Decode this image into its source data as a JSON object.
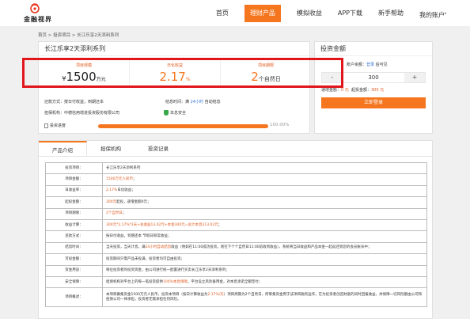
{
  "brand": {
    "logo_text": "金融视界",
    "accent": "#f5761e",
    "alert_box_color": "#e0161b"
  },
  "nav": [
    {
      "label": "首页",
      "active": false
    },
    {
      "label": "理财产品",
      "active": true
    },
    {
      "label": "模拟收益",
      "active": false
    },
    {
      "label": "APP下载",
      "active": false
    },
    {
      "label": "新手帮助",
      "active": false
    },
    {
      "label": "我的账户",
      "active": false,
      "badge": "▾"
    }
  ],
  "breadcrumb": "首页 > 投资项目 > 长江乐享2天添利系列",
  "product": {
    "title": "长江乐享2天添利系列",
    "scale_label": "项目规模",
    "scale_currency": "¥",
    "scale_value": "1500",
    "scale_unit": "万元",
    "rate_label": "日化收益",
    "rate_value": "2.17",
    "rate_unit": "%",
    "term_label": "项目期限",
    "term_value": "2",
    "term_unit": "个自然日",
    "repay_label": "还款方式：",
    "repay_value": "按日付收益，到期还本",
    "settle_label": "结息时间：满",
    "settle_hours": "24小时",
    "settle_tail": "自动结息",
    "guarantor_label": "担保机构：",
    "guarantor_value": "中德信用增进投资股份有限公司",
    "safety_label": "本息安全",
    "progress_label": "投资进度",
    "progress_value": "100.00%",
    "progress_fraction": 1.0
  },
  "invest": {
    "title": "投资金额",
    "balance_label": "账户余额：",
    "balance_link": "登录",
    "balance_tail": "后可见",
    "minus": "-",
    "amount": "300",
    "plus": "+",
    "min_label": "递增金额：",
    "min_value": "0 元",
    "start_label": "起投金额：",
    "start_value": "300 元",
    "login_button": "立即登录"
  },
  "tabs": [
    {
      "label": "产品介绍",
      "active": true
    },
    {
      "label": "担保机构",
      "active": false
    },
    {
      "label": "投资记录",
      "active": false
    }
  ],
  "details": [
    {
      "label": "投资项目：",
      "value": "长江乐享2天添利系列"
    },
    {
      "label": "项目金额：",
      "value_hl": "1500万元人民币",
      "value": "；"
    },
    {
      "label": "日收益率：",
      "value_hl": "2.17%",
      "value": "日化收益；"
    },
    {
      "label": "起投金额：",
      "value_hl": "300元",
      "value": "起投，递增金额0元；"
    },
    {
      "label": "项目期限：",
      "value_hl": "2个自然日",
      "value": "；"
    },
    {
      "label": "收益计算：",
      "value_hl": "300元*2.17%*2天+总收益13.02元+本金300元=总计本息313.02元",
      "value": "；"
    },
    {
      "label": "还款方式：",
      "value": "按日付收益，到期还本 节假日照常收益；"
    },
    {
      "label": "结息时间：",
      "value_pre": "当天投资，当天计息，满",
      "value_hl": "24小时自动结息",
      "value": "收益（例如在11:00成功投资，则在下个个自然日11:00前收到收益），系统将当日收益和产品本金一起返还到您的会员账号中；"
    },
    {
      "label": "可投金额：",
      "value": "投资期间只需产品未投满，投资者均可自由投资；"
    },
    {
      "label": "资金用途：",
      "value": "每位投资者的投资资金，由公司进行统一配置进行买卖长江乐享2天添利系列；"
    },
    {
      "label": "安全保障：",
      "value_pre": "担保机构对平台上的每一笔投资提供",
      "value_hl": "100%本息保障",
      "value": "，平台设立风险备用金，对本息承诺全额垫付；"
    },
    {
      "label": "项目概述：",
      "value_pre": "本项目募集资金1500万元人民币，投资本项目（按日计算收益为",
      "value_hl": "2.17%/天",
      "value": "）项目周期为2个自然日，所筹集资金用于该项目融资运作，在为投资者创造财富的同时回报收益，并保障一切风险都由公司和担保公司一律承担，投资者无需承担任何风险。"
    }
  ]
}
